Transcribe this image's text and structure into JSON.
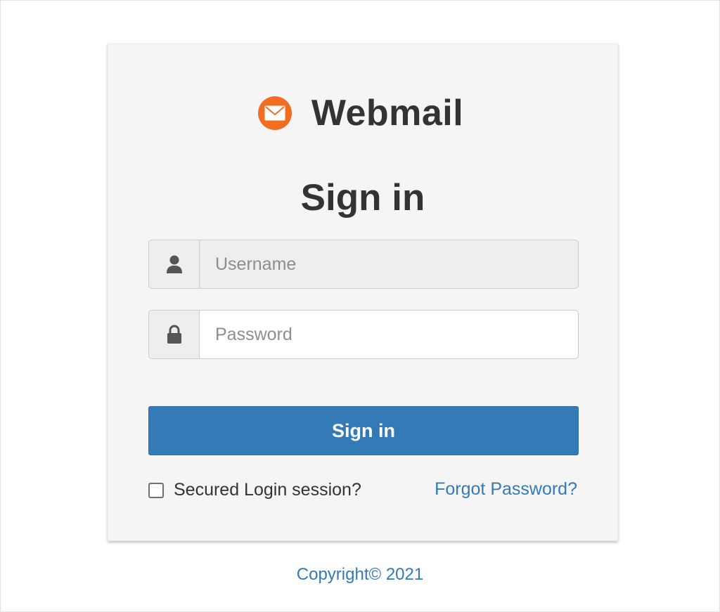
{
  "brand": {
    "title": "Webmail",
    "icon": "envelope-icon",
    "icon_color": "#f26c22"
  },
  "form": {
    "heading": "Sign in",
    "username": {
      "icon": "user-icon",
      "placeholder": "Username",
      "value": ""
    },
    "password": {
      "icon": "lock-icon",
      "placeholder": "Password",
      "value": ""
    },
    "submit_label": "Sign in",
    "secured_session_label": "Secured Login session?",
    "secured_session_checked": false,
    "forgot_password_label": "Forgot Password?"
  },
  "footer": {
    "copyright": "Copyright© 2021"
  },
  "colors": {
    "primary": "#337ab7",
    "brand_orange": "#f26c22",
    "card_bg": "#f5f5f5",
    "text_dark": "#333333"
  }
}
